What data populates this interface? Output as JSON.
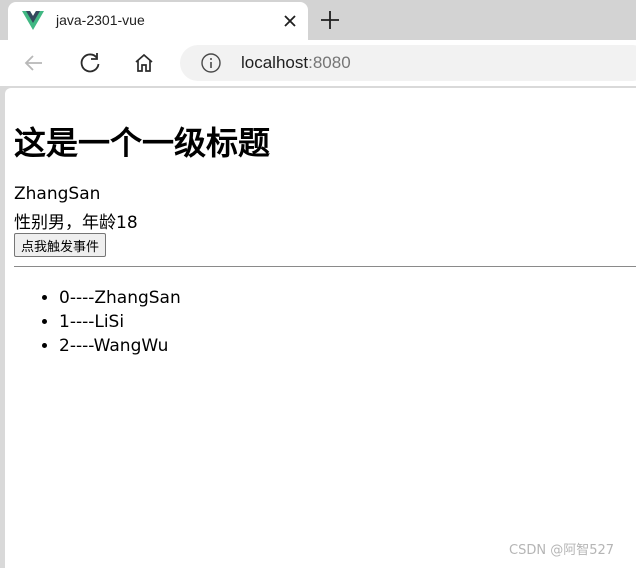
{
  "browser": {
    "tab": {
      "title": "java-2301-vue",
      "favicon": "vue-logo-icon"
    },
    "address": {
      "host": "localhost",
      "port": ":8080"
    },
    "colors": {
      "vue_green": "#41b883",
      "vue_dark": "#35495e"
    }
  },
  "page": {
    "heading": "这是一个一级标题",
    "name": "ZhangSan",
    "info": "性别男，年龄18",
    "button_label": "点我触发事件",
    "list": [
      {
        "text": "0----ZhangSan"
      },
      {
        "text": "1----LiSi"
      },
      {
        "text": "2----WangWu"
      }
    ]
  },
  "watermark": "CSDN @阿智527"
}
